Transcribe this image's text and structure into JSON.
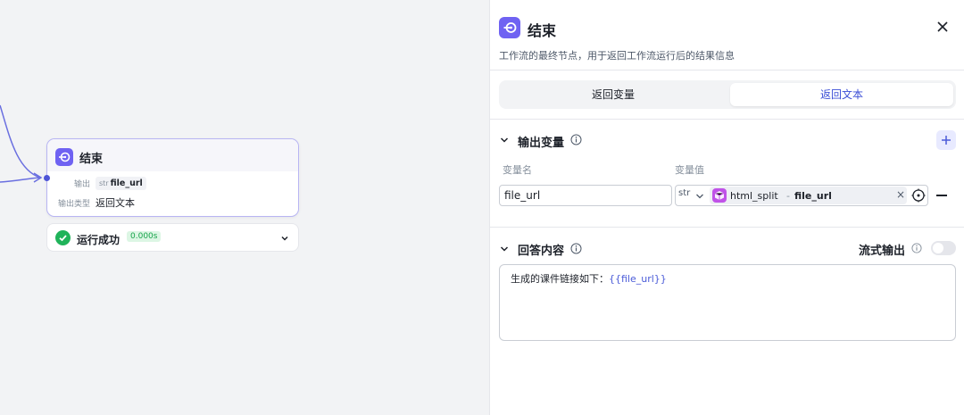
{
  "node": {
    "title": "结束",
    "output_label": "输出",
    "output_var_type": "str",
    "output_var_name": "file_url",
    "output_type_label": "输出类型",
    "output_type_value": "返回文本"
  },
  "status": {
    "text": "运行成功",
    "time": "0.000s"
  },
  "panel": {
    "title": "结束",
    "description": "工作流的最终节点，用于返回工作流运行后的结果信息",
    "tabs": [
      {
        "label": "返回变量",
        "active": false
      },
      {
        "label": "返回文本",
        "active": true
      }
    ],
    "output_section": {
      "title": "输出变量",
      "col_name": "变量名",
      "col_value": "变量值",
      "rows": [
        {
          "name": "file_url",
          "type": "str",
          "source_node": "html_split",
          "separator": "-",
          "source_var": "file_url"
        }
      ]
    },
    "answer_section": {
      "title": "回答内容",
      "stream_label": "流式输出",
      "stream_enabled": false,
      "content_prefix": "生成的课件链接如下：",
      "content_var": "{{file_url}}"
    }
  },
  "colors": {
    "accent": "#6f62f2",
    "link": "#3c4fd6",
    "success": "#20b35a",
    "chip_icon": "#c052e8"
  },
  "icons": [
    "end-node-icon",
    "close-icon",
    "chevron-down-icon",
    "info-icon",
    "plus-icon",
    "check-circle-icon",
    "cube-icon",
    "target-icon",
    "minus-icon"
  ]
}
